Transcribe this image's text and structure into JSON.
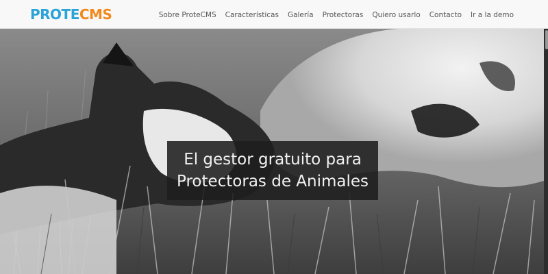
{
  "brand": {
    "logo_part1": "PROTE",
    "logo_part2": "CMS",
    "color_primary": "#2aa3d8",
    "color_accent": "#f08a1c"
  },
  "nav": {
    "items": [
      {
        "label": "Sobre ProteCMS"
      },
      {
        "label": "Características"
      },
      {
        "label": "Galería"
      },
      {
        "label": "Protectoras"
      },
      {
        "label": "Quiero usarlo"
      },
      {
        "label": "Contacto"
      },
      {
        "label": "Ir a la demo"
      }
    ]
  },
  "hero": {
    "image_subject": "black-and-white photo of a cat and a dog nuzzling in grass",
    "headline_line1": "El gestor gratuito para",
    "headline_line2": "Protectoras de Animales"
  }
}
